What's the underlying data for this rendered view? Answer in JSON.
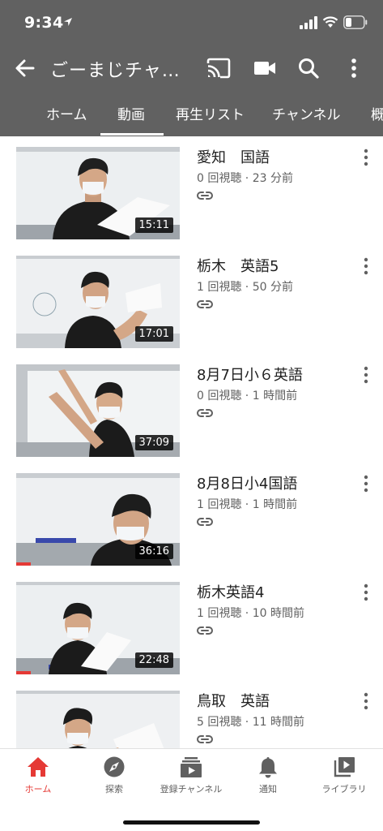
{
  "status_bar": {
    "time": "9:34"
  },
  "app_bar": {
    "title": "ごーまじチャ…",
    "icons": [
      "back-arrow-icon",
      "cast-icon",
      "video-camera-icon",
      "search-icon",
      "more-vert-icon"
    ]
  },
  "tabs": [
    {
      "label": "ホーム",
      "active": false
    },
    {
      "label": "動画",
      "active": true
    },
    {
      "label": "再生リスト",
      "active": false
    },
    {
      "label": "チャンネル",
      "active": false
    },
    {
      "label": "概",
      "active": false
    }
  ],
  "videos": [
    {
      "title": "愛知　国語",
      "meta": "0 回視聴 · 23 分前",
      "duration": "15:11",
      "progress": 0
    },
    {
      "title": "栃木　英語5",
      "meta": "1 回視聴 · 50 分前",
      "duration": "17:01",
      "progress": 0
    },
    {
      "title": "8月7日小６英語",
      "meta": "0 回視聴 · 1 時間前",
      "duration": "37:09",
      "progress": 0
    },
    {
      "title": "8月8日小4国語",
      "meta": "1 回視聴 · 1 時間前",
      "duration": "36:16",
      "progress": 0.09
    },
    {
      "title": "栃木英語4",
      "meta": "1 回視聴 · 10 時間前",
      "duration": "22:48",
      "progress": 0.09
    },
    {
      "title": "鳥取　英語",
      "meta": "5 回視聴 · 11 時間前",
      "duration": "",
      "progress": 0
    }
  ],
  "bottom_nav": [
    {
      "label": "ホーム",
      "icon": "home-icon",
      "active": true
    },
    {
      "label": "探索",
      "icon": "compass-icon",
      "active": false
    },
    {
      "label": "登録チャンネル",
      "icon": "subscriptions-icon",
      "active": false
    },
    {
      "label": "通知",
      "icon": "bell-icon",
      "active": false
    },
    {
      "label": "ライブラリ",
      "icon": "library-icon",
      "active": false
    }
  ],
  "colors": {
    "header": "#616161",
    "accent": "#e53935",
    "text": "#212121",
    "meta": "#606060"
  }
}
